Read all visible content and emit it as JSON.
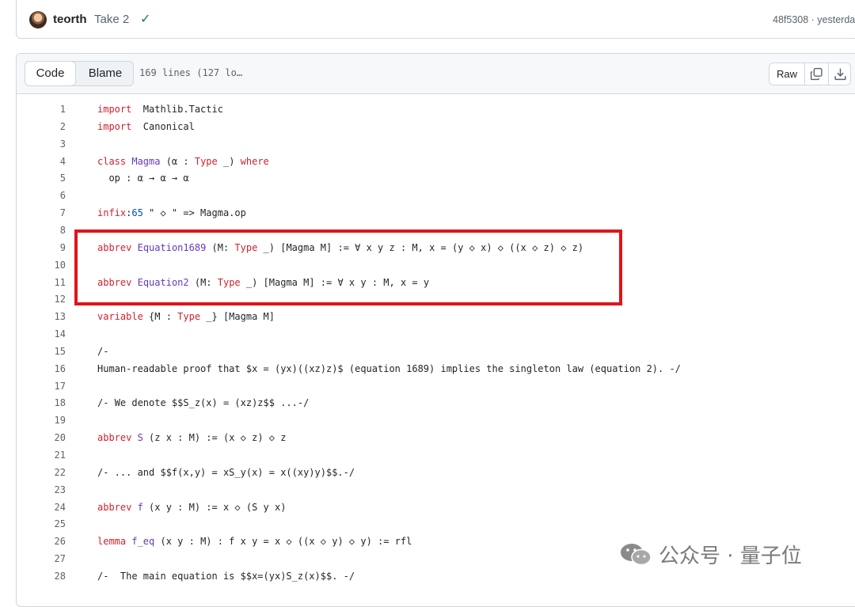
{
  "commit": {
    "author": "teorth",
    "message": "Take 2",
    "check_icon": "check-icon",
    "sha_time": "48f5308 · yesterda"
  },
  "file_header": {
    "code_tab": "Code",
    "blame_tab": "Blame",
    "lines_info": "169 lines (127 lo…",
    "raw_label": "Raw",
    "copy_icon": "copy-icon",
    "download_icon": "download-icon"
  },
  "code_lines": [
    {
      "n": "1",
      "parts": [
        [
          "kw",
          "import"
        ],
        [
          "",
          "  Mathlib.Tactic"
        ]
      ]
    },
    {
      "n": "2",
      "parts": [
        [
          "kw",
          "import"
        ],
        [
          "",
          "  Canonical"
        ]
      ]
    },
    {
      "n": "3",
      "parts": []
    },
    {
      "n": "4",
      "parts": [
        [
          "kw",
          "class"
        ],
        [
          "",
          " "
        ],
        [
          "ty",
          "Magma"
        ],
        [
          "",
          " (α : "
        ],
        [
          "kw",
          "Type"
        ],
        [
          "",
          " _) "
        ],
        [
          "kw",
          "where"
        ]
      ]
    },
    {
      "n": "5",
      "parts": [
        [
          "",
          "  op : α → α → α"
        ]
      ]
    },
    {
      "n": "6",
      "parts": []
    },
    {
      "n": "7",
      "parts": [
        [
          "kw",
          "infix"
        ],
        [
          "",
          ":"
        ],
        [
          "nm",
          "65"
        ],
        [
          "",
          " \" ◇ \" => Magma.op"
        ]
      ]
    },
    {
      "n": "8",
      "parts": []
    },
    {
      "n": "9",
      "parts": [
        [
          "kw",
          "abbrev"
        ],
        [
          "",
          " "
        ],
        [
          "ty",
          "Equation1689"
        ],
        [
          "",
          " (M: "
        ],
        [
          "kw",
          "Type"
        ],
        [
          "",
          " _) [Magma M] := ∀ x y z : M, x = (y ◇ x) ◇ ((x ◇ z) ◇ z)"
        ]
      ]
    },
    {
      "n": "10",
      "parts": []
    },
    {
      "n": "11",
      "parts": [
        [
          "kw",
          "abbrev"
        ],
        [
          "",
          " "
        ],
        [
          "ty",
          "Equation2"
        ],
        [
          "",
          " (M: "
        ],
        [
          "kw",
          "Type"
        ],
        [
          "",
          " _) [Magma M] := ∀ x y : M, x = y"
        ]
      ]
    },
    {
      "n": "12",
      "parts": []
    },
    {
      "n": "13",
      "parts": [
        [
          "kw",
          "variable"
        ],
        [
          "",
          " {M : "
        ],
        [
          "kw",
          "Type"
        ],
        [
          "",
          " _} [Magma M]"
        ]
      ]
    },
    {
      "n": "14",
      "parts": []
    },
    {
      "n": "15",
      "parts": [
        [
          "",
          "/-"
        ]
      ]
    },
    {
      "n": "16",
      "parts": [
        [
          "",
          "Human-readable proof that $x = (yx)((xz)z)$ (equation 1689) implies the singleton law (equation 2). -/"
        ]
      ]
    },
    {
      "n": "17",
      "parts": []
    },
    {
      "n": "18",
      "parts": [
        [
          "",
          "/- We denote $$S_z(x) = (xz)z$$ ...-/"
        ]
      ]
    },
    {
      "n": "19",
      "parts": []
    },
    {
      "n": "20",
      "parts": [
        [
          "kw",
          "abbrev"
        ],
        [
          "",
          " "
        ],
        [
          "ty",
          "S"
        ],
        [
          "",
          " (z x : M) := (x ◇ z) ◇ z"
        ]
      ]
    },
    {
      "n": "21",
      "parts": []
    },
    {
      "n": "22",
      "parts": [
        [
          "",
          "/- ... and $$f(x,y) = xS_y(x) = x((xy)y)$$.-/"
        ]
      ]
    },
    {
      "n": "23",
      "parts": []
    },
    {
      "n": "24",
      "parts": [
        [
          "kw",
          "abbrev"
        ],
        [
          "",
          " "
        ],
        [
          "ty",
          "f"
        ],
        [
          "",
          " (x y : M) := x ◇ (S y x)"
        ]
      ]
    },
    {
      "n": "25",
      "parts": []
    },
    {
      "n": "26",
      "parts": [
        [
          "kw",
          "lemma"
        ],
        [
          "",
          " "
        ],
        [
          "ty",
          "f_eq"
        ],
        [
          "",
          " (x y : M) : f x y = x ◇ ((x ◇ y) ◇ y) := rfl"
        ]
      ]
    },
    {
      "n": "27",
      "parts": []
    },
    {
      "n": "28",
      "parts": [
        [
          "",
          "/-  The main equation is $$x=(yx)S_z(x)$$. -/"
        ]
      ]
    }
  ],
  "watermark": {
    "icon": "wechat-icon",
    "text": "公众号 · 量子位"
  },
  "colors": {
    "keyword": "#cf222e",
    "type": "#6639ba",
    "number": "#0550ae",
    "highlight_box": "#e0141a",
    "check": "#1a7f37"
  }
}
